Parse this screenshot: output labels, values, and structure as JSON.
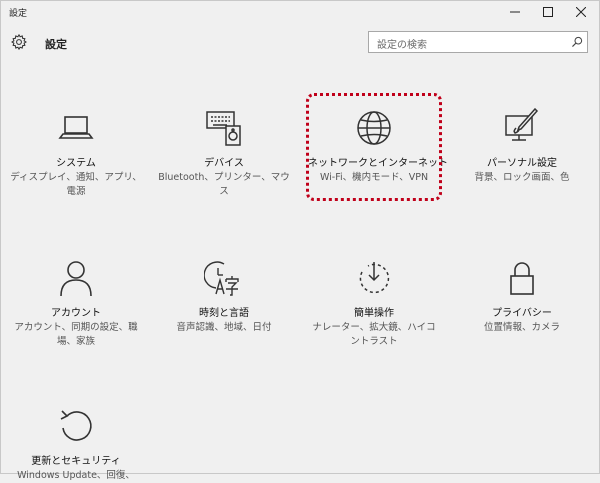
{
  "window": {
    "title": "設定"
  },
  "header": {
    "title": "設定"
  },
  "search": {
    "placeholder": "設定の検索"
  },
  "tiles": [
    {
      "label": "システム",
      "desc": "ディスプレイ、通知、アプリ、電源",
      "icon": "laptop-icon"
    },
    {
      "label": "デバイス",
      "desc": "Bluetooth、プリンター、マウス",
      "icon": "devices-icon"
    },
    {
      "label": "ネットワークとインターネット",
      "desc": "Wi-Fi、機内モード、VPN",
      "icon": "globe-icon"
    },
    {
      "label": "パーソナル設定",
      "desc": "背景、ロック画面、色",
      "icon": "personalization-icon"
    },
    {
      "label": "アカウント",
      "desc": "アカウント、同期の設定、職場、家族",
      "icon": "person-icon"
    },
    {
      "label": "時刻と言語",
      "desc": "音声認識、地域、日付",
      "icon": "time-language-icon"
    },
    {
      "label": "簡単操作",
      "desc": "ナレーター、拡大鏡、ハイコントラスト",
      "icon": "ease-of-access-icon"
    },
    {
      "label": "プライバシー",
      "desc": "位置情報、カメラ",
      "icon": "lock-icon"
    },
    {
      "label": "更新とセキュリティ",
      "desc": "Windows Update、回復、",
      "icon": "update-icon"
    }
  ],
  "colors": {
    "highlight": "#c0001a",
    "background": "#f0f0f0"
  }
}
